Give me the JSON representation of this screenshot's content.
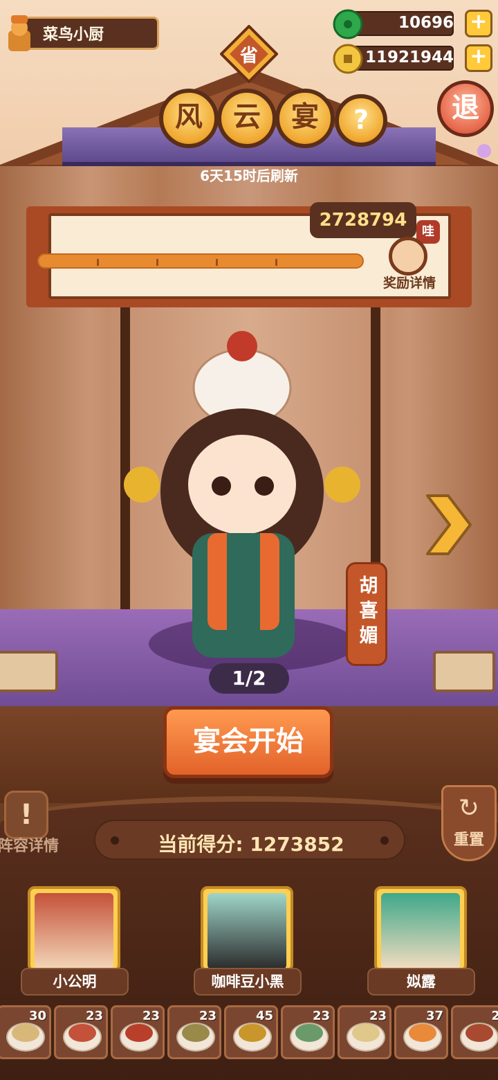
{
  "player": {
    "name": "菜鸟小厨"
  },
  "currency": {
    "jade": {
      "value": "10696",
      "plus": "+"
    },
    "coins": {
      "value": "11921944",
      "plus": "+"
    }
  },
  "header": {
    "province_badge": "省",
    "title_chars": [
      "风",
      "云",
      "宴"
    ],
    "help": "?",
    "exit": "退",
    "refresh_text": "6天15时后刷新"
  },
  "progress": {
    "target_score": "2728794",
    "wa_tag": "哇",
    "reward_label": "奖励详情",
    "fill_fraction": 1.0
  },
  "character": {
    "name": "胡喜媚",
    "page_indicator": "1/2"
  },
  "actions": {
    "start": "宴会开始",
    "lineup_details": "阵容详情",
    "lineup_icon": "!",
    "reset": "重置",
    "reset_icon": "↻"
  },
  "score": {
    "current": "当前得分: 1273852"
  },
  "chefs": [
    {
      "name": "小公明"
    },
    {
      "name": "咖啡豆小黑"
    },
    {
      "name": "姒露"
    }
  ],
  "dishes": [
    {
      "count": "30"
    },
    {
      "count": "23"
    },
    {
      "count": "23"
    },
    {
      "count": "23"
    },
    {
      "count": "45"
    },
    {
      "count": "23"
    },
    {
      "count": "23"
    },
    {
      "count": "37"
    },
    {
      "count": "2"
    }
  ],
  "colors": {
    "accent_orange": "#e2622a",
    "panel_brown": "#5a3120",
    "gold": "#ffc93a",
    "stage_purple": "#6c4a92"
  }
}
